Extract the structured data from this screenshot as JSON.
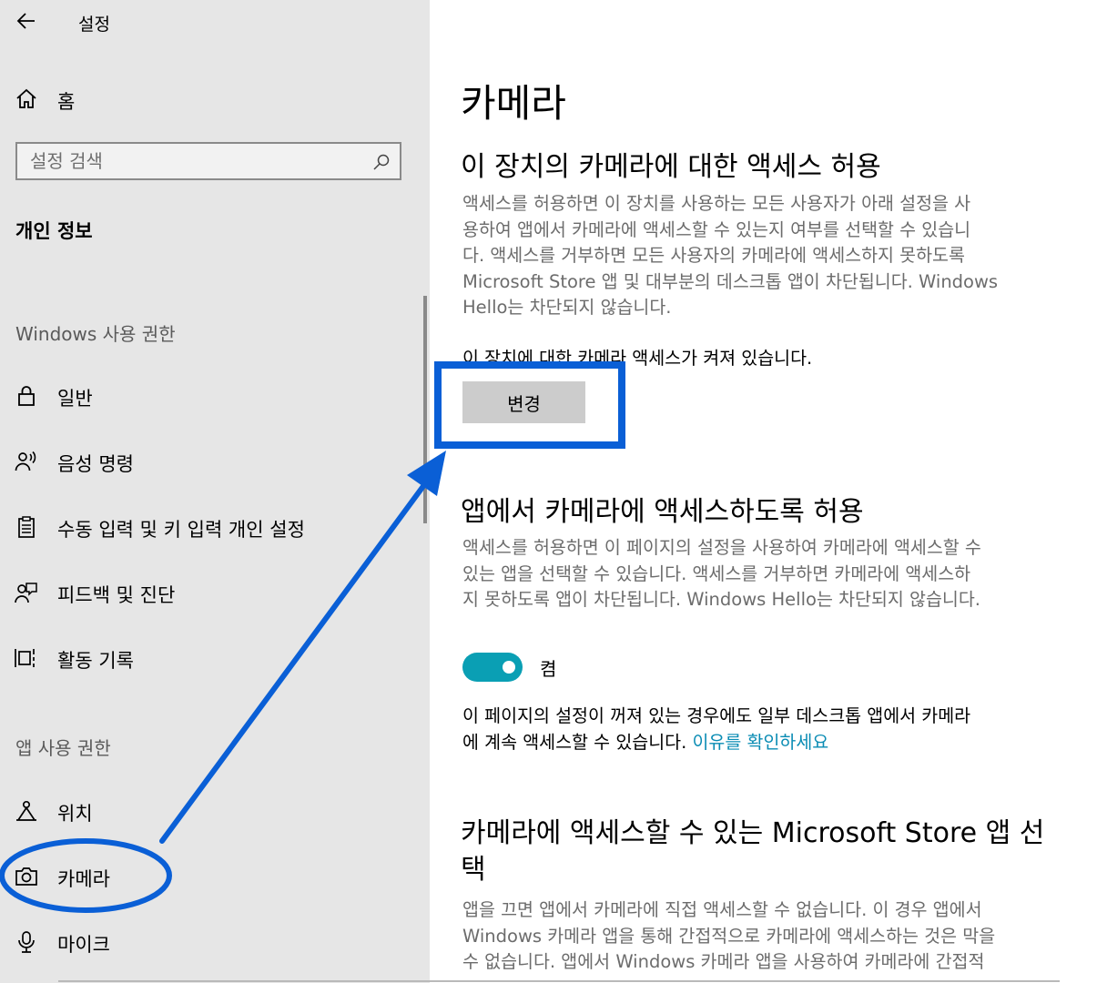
{
  "window": {
    "title": "설정"
  },
  "sidebar": {
    "home_label": "홈",
    "search": {
      "placeholder": "설정 검색"
    },
    "group_title": "개인 정보",
    "section_windows": "Windows 사용 권한",
    "section_apps": "앱 사용 권한",
    "windows_items": [
      {
        "label": "일반",
        "icon": "lock-icon"
      },
      {
        "label": "음성 명령",
        "icon": "speech-icon"
      },
      {
        "label": "수동 입력 및 키 입력 개인 설정",
        "icon": "clipboard-icon"
      },
      {
        "label": "피드백 및 진단",
        "icon": "feedback-icon"
      },
      {
        "label": "활동 기록",
        "icon": "timeline-icon"
      }
    ],
    "app_items": [
      {
        "label": "위치",
        "icon": "location-icon"
      },
      {
        "label": "카메라",
        "icon": "camera-icon"
      },
      {
        "label": "마이크",
        "icon": "microphone-icon"
      }
    ]
  },
  "main": {
    "title": "카메라",
    "section1": {
      "heading": "이 장치의 카메라에 대한 액세스 허용",
      "desc_lines": [
        "액세스를 허용하면 이 장치를 사용하는 모든 사용자가 아래 설정을 사",
        "용하여 앱에서 카메라에 액세스할 수 있는지 여부를 선택할 수 있습니",
        "다. 액세스를 거부하면 모든 사용자의 카메라에 액세스하지 못하도록",
        "Microsoft Store 앱 및 대부분의 데스크톱 앱이 차단됩니다. Windows",
        "Hello는 차단되지 않습니다."
      ],
      "status": "이 장치에 대한 카메라 액세스가 켜져 있습니다.",
      "change_button": "변경"
    },
    "section2": {
      "heading": "앱에서 카메라에 액세스하도록 허용",
      "desc_lines": [
        "액세스를 허용하면 이 페이지의 설정을 사용하여 카메라에 액세스할 수",
        "있는 앱을 선택할 수 있습니다. 액세스를 거부하면 카메라에 액세스하",
        "지 못하도록 앱이 차단됩니다. Windows Hello는 차단되지 않습니다."
      ],
      "toggle_label": "켬",
      "toggle_on": true,
      "note_line1": "이 페이지의 설정이 꺼져 있는 경우에도 일부 데스크톱 앱에서 카메라",
      "note_line2": "에 계속 액세스할 수 있습니다. ",
      "note_link": "이유를 확인하세요"
    },
    "section3": {
      "heading_lines": [
        "카메라에 액세스할 수 있는 Microsoft Store 앱 선",
        "택"
      ],
      "desc_lines": [
        "앱을 끄면 앱에서 카메라에 직접 액세스할 수 없습니다. 이 경우 앱에서",
        "Windows 카메라 앱을 통해 간접적으로 카메라에 액세스하는 것은 막을",
        "수 없습니다. 앱에서 Windows 카메라 앱을 사용하여 카메라에 간접적"
      ]
    }
  },
  "colors": {
    "sidebar_bg": "#e6e6e6",
    "accent": "#0a9fb4",
    "link": "#0a8cb4",
    "annotation": "#0a5fd6"
  }
}
